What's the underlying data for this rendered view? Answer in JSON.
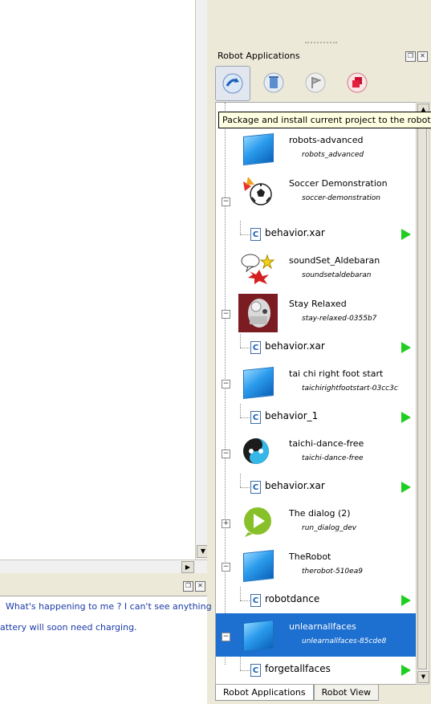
{
  "log": {
    "lines": [
      "What's   happening to me ? I can't see anything",
      "attery will soon need charging."
    ]
  },
  "dock": {
    "title": "Robot Applications",
    "tooltip": "Package and install current project to the robot",
    "toolbar": [
      "package-install-icon",
      "trash-icon",
      "flag-icon",
      "stop-all-icon"
    ]
  },
  "tree": {
    "items": [
      {
        "kind": "app",
        "name": "robots-advanced",
        "id": "robots_advanced",
        "icon": "cube-icon"
      },
      {
        "kind": "app",
        "name": "Soccer Demonstration",
        "id": "soccer-demonstration",
        "icon": "soccer-ball-icon",
        "expanded": true
      },
      {
        "kind": "behavior",
        "name": "behavior.xar"
      },
      {
        "kind": "app",
        "name": "soundSet_Aldebaran",
        "id": "soundsetaldebaran",
        "icon": "speech-bubble-icon"
      },
      {
        "kind": "app",
        "name": "Stay Relaxed",
        "id": "stay-relaxed-0355b7",
        "icon": "robot-photo-icon",
        "expanded": true
      },
      {
        "kind": "behavior",
        "name": "behavior.xar"
      },
      {
        "kind": "app",
        "name": "tai chi right foot start",
        "id": "taichirightfootstart-03cc3c",
        "icon": "cube-icon",
        "expanded": true
      },
      {
        "kind": "behavior",
        "name": "behavior_1"
      },
      {
        "kind": "app",
        "name": "taichi-dance-free",
        "id": "taichi-dance-free",
        "icon": "yin-yang-icon",
        "expanded": true
      },
      {
        "kind": "behavior",
        "name": "behavior.xar"
      },
      {
        "kind": "app",
        "name": "The dialog (2)",
        "id": "run_dialog_dev",
        "icon": "dialog-play-icon",
        "expanded": false
      },
      {
        "kind": "app",
        "name": "TheRobot",
        "id": "therobot-510ea9",
        "icon": "cube-icon",
        "expanded": true
      },
      {
        "kind": "behavior",
        "name": "robotdance"
      },
      {
        "kind": "app",
        "name": "unlearnallfaces",
        "id": "unlearnallfaces-85cde8",
        "icon": "cube-icon",
        "expanded": true,
        "selected": true
      },
      {
        "kind": "behavior",
        "name": "forgetallfaces"
      }
    ]
  },
  "tabs": [
    "Robot Applications",
    "Robot View"
  ],
  "colors": {
    "selection": "#1d6fd0",
    "play": "#1fce1f",
    "log_text": "#1a3aa8",
    "tooltip_bg": "#ffffe1"
  }
}
